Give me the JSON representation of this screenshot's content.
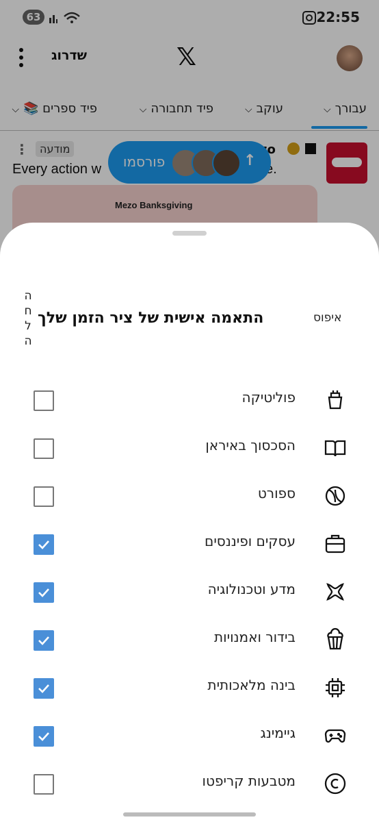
{
  "status": {
    "notification_count": "63",
    "time": "22:55"
  },
  "app": {
    "upgrade_label": "שדרוג",
    "logo": "𝕏"
  },
  "tabs": [
    {
      "label": "עבורך"
    },
    {
      "label": "עוקב"
    },
    {
      "label": "פיד תחבורה"
    },
    {
      "label": "פיד ספרים 📚"
    }
  ],
  "post": {
    "handle": "zo",
    "ad_label": "מודעה",
    "text": "Every action w",
    "text_end": "e.",
    "card_title": "Mezo Banksgiving"
  },
  "publish": {
    "label": "פורסמו",
    "arrow": "↑"
  },
  "sheet": {
    "reset_label": "איפוס",
    "title": "התאמה אישית של ציר הזמן שלך",
    "help_label": "החלה",
    "topics": [
      {
        "label": "פוליטיקה",
        "icon": "podium-icon",
        "checked": false
      },
      {
        "label": "הסכסוך באיראן",
        "icon": "book-icon",
        "checked": false
      },
      {
        "label": "ספורט",
        "icon": "ball-icon",
        "checked": false
      },
      {
        "label": "עסקים ופיננסים",
        "icon": "briefcase-icon",
        "checked": true
      },
      {
        "label": "מדע וטכנולוגיה",
        "icon": "atom-icon",
        "checked": true
      },
      {
        "label": "בידור ואמנויות",
        "icon": "popcorn-icon",
        "checked": true
      },
      {
        "label": "בינה מלאכותית",
        "icon": "chip-icon",
        "checked": true
      },
      {
        "label": "גיימינג",
        "icon": "gamepad-icon",
        "checked": true
      },
      {
        "label": "מטבעות קריפטו",
        "icon": "coin-icon",
        "checked": false
      }
    ]
  },
  "colors": {
    "accent": "#1d9bf0",
    "checkbox_on": "#4a8fd8"
  }
}
